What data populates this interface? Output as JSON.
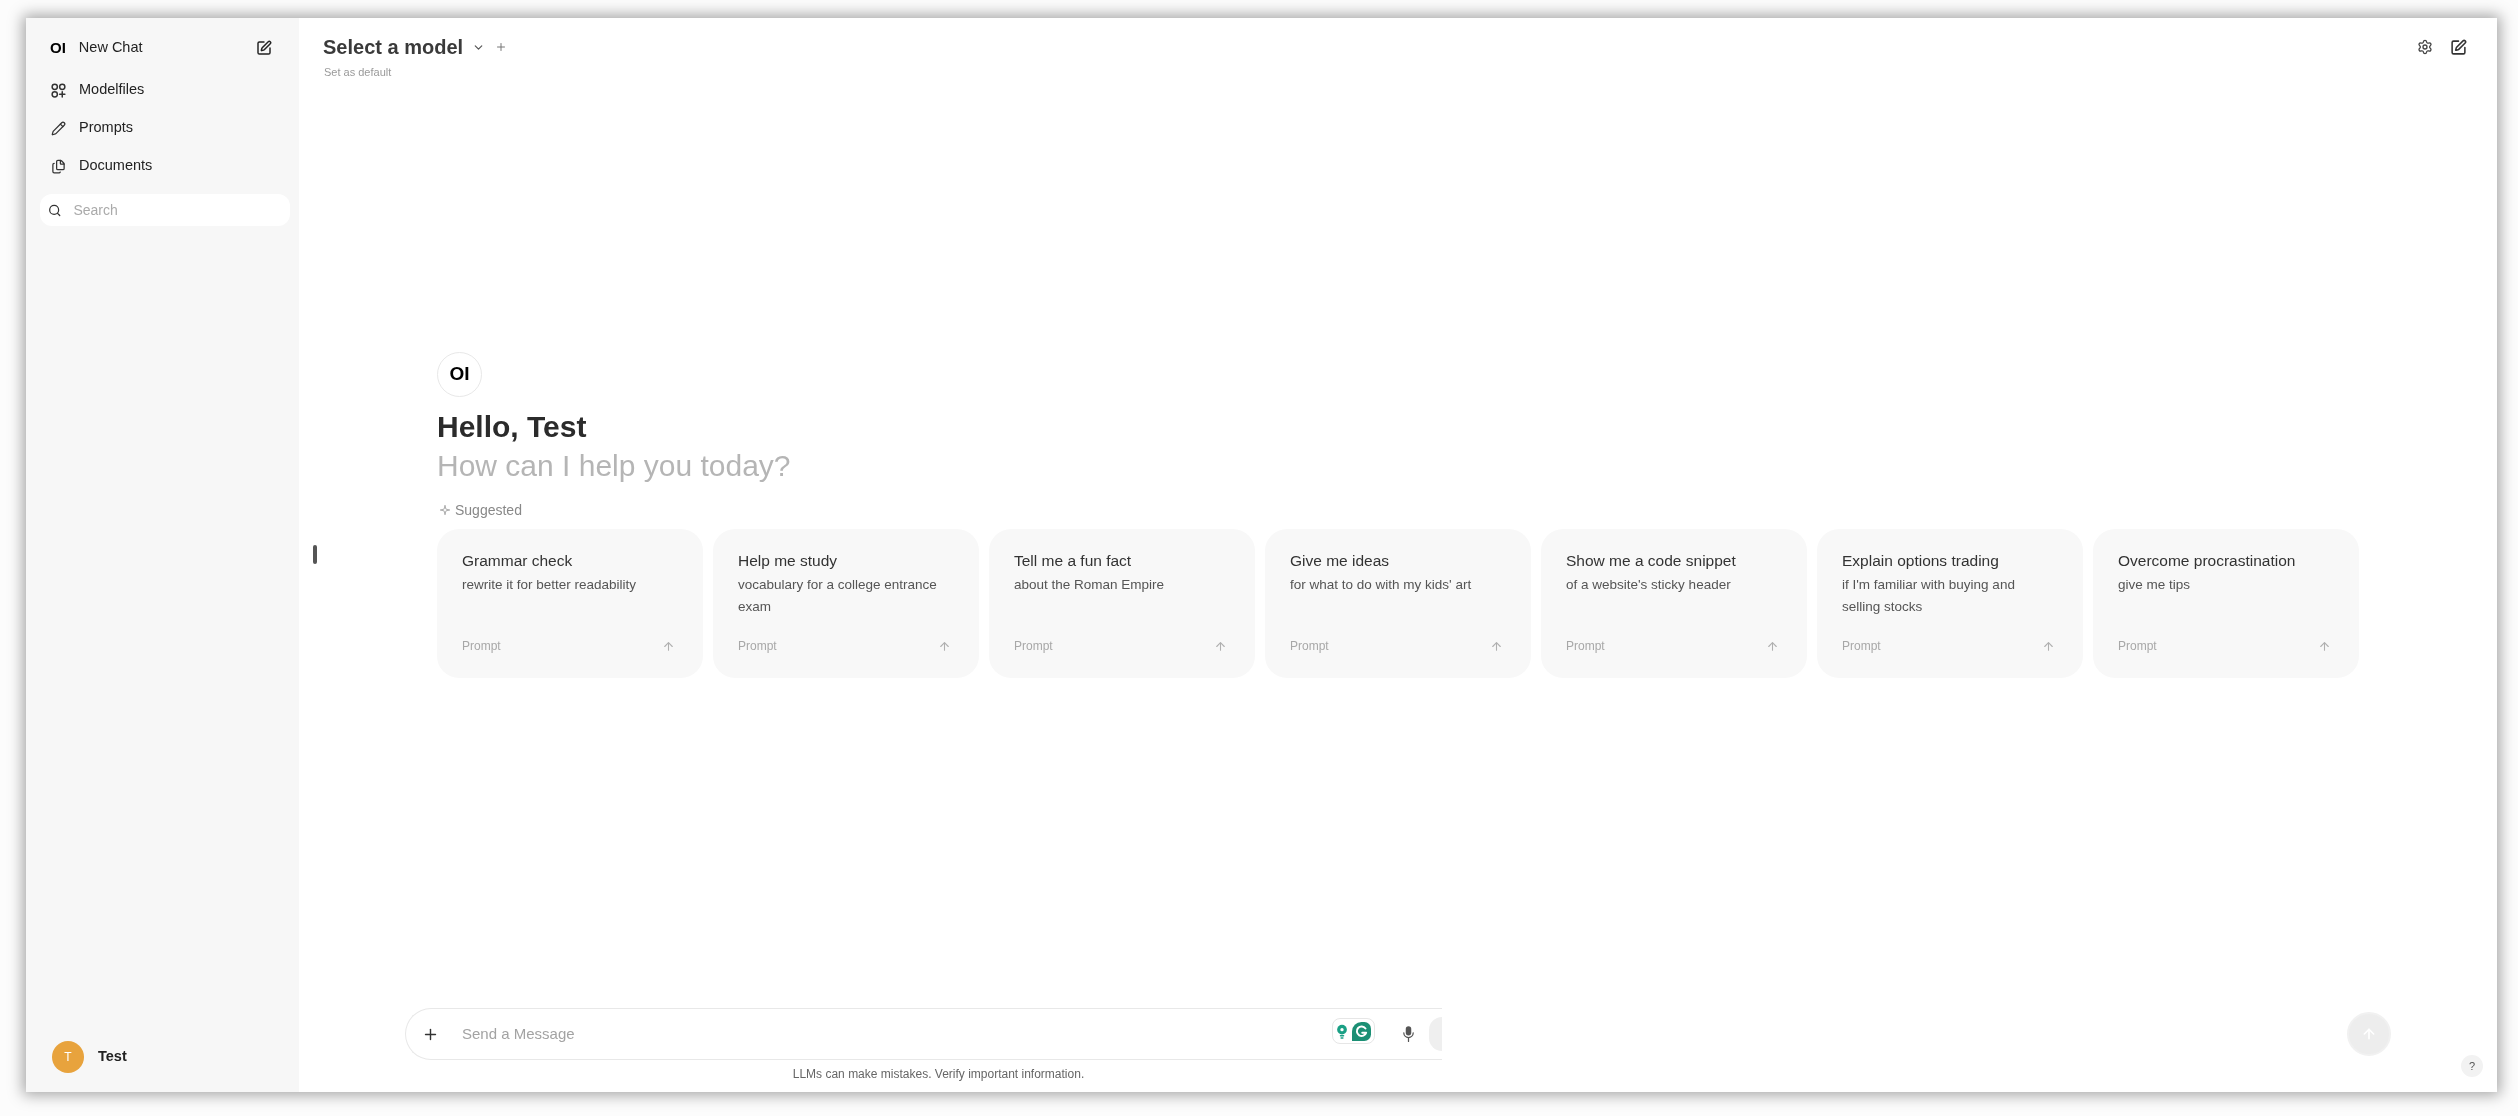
{
  "sidebar": {
    "brand": "OI",
    "new_chat": "New Chat",
    "items": [
      {
        "label": "Modelfiles"
      },
      {
        "label": "Prompts"
      },
      {
        "label": "Documents"
      }
    ],
    "search": {
      "placeholder": "Search"
    },
    "user": {
      "initial": "T",
      "name": "Test"
    }
  },
  "header": {
    "model_selector": "Select a model",
    "set_default": "Set as default"
  },
  "welcome": {
    "logo": "OI",
    "greeting": "Hello, Test",
    "subtitle": "How can I help you today?",
    "suggested_label": "Suggested"
  },
  "suggestions": [
    {
      "title": "Grammar check",
      "subtitle": "rewrite it for better readability",
      "tag": "Prompt"
    },
    {
      "title": "Help me study",
      "subtitle": "vocabulary for a college entrance exam",
      "tag": "Prompt"
    },
    {
      "title": "Tell me a fun fact",
      "subtitle": "about the Roman Empire",
      "tag": "Prompt"
    },
    {
      "title": "Give me ideas",
      "subtitle": "for what to do with my kids' art",
      "tag": "Prompt"
    },
    {
      "title": "Show me a code snippet",
      "subtitle": "of a website's sticky header",
      "tag": "Prompt"
    },
    {
      "title": "Explain options trading",
      "subtitle": "if I'm familiar with buying and selling stocks",
      "tag": "Prompt"
    },
    {
      "title": "Overcome procrastination",
      "subtitle": "give me tips",
      "tag": "Prompt"
    }
  ],
  "composer": {
    "placeholder": "Send a Message",
    "disclaimer": "LLMs can make mistakes. Verify important information."
  },
  "help_button": "?"
}
